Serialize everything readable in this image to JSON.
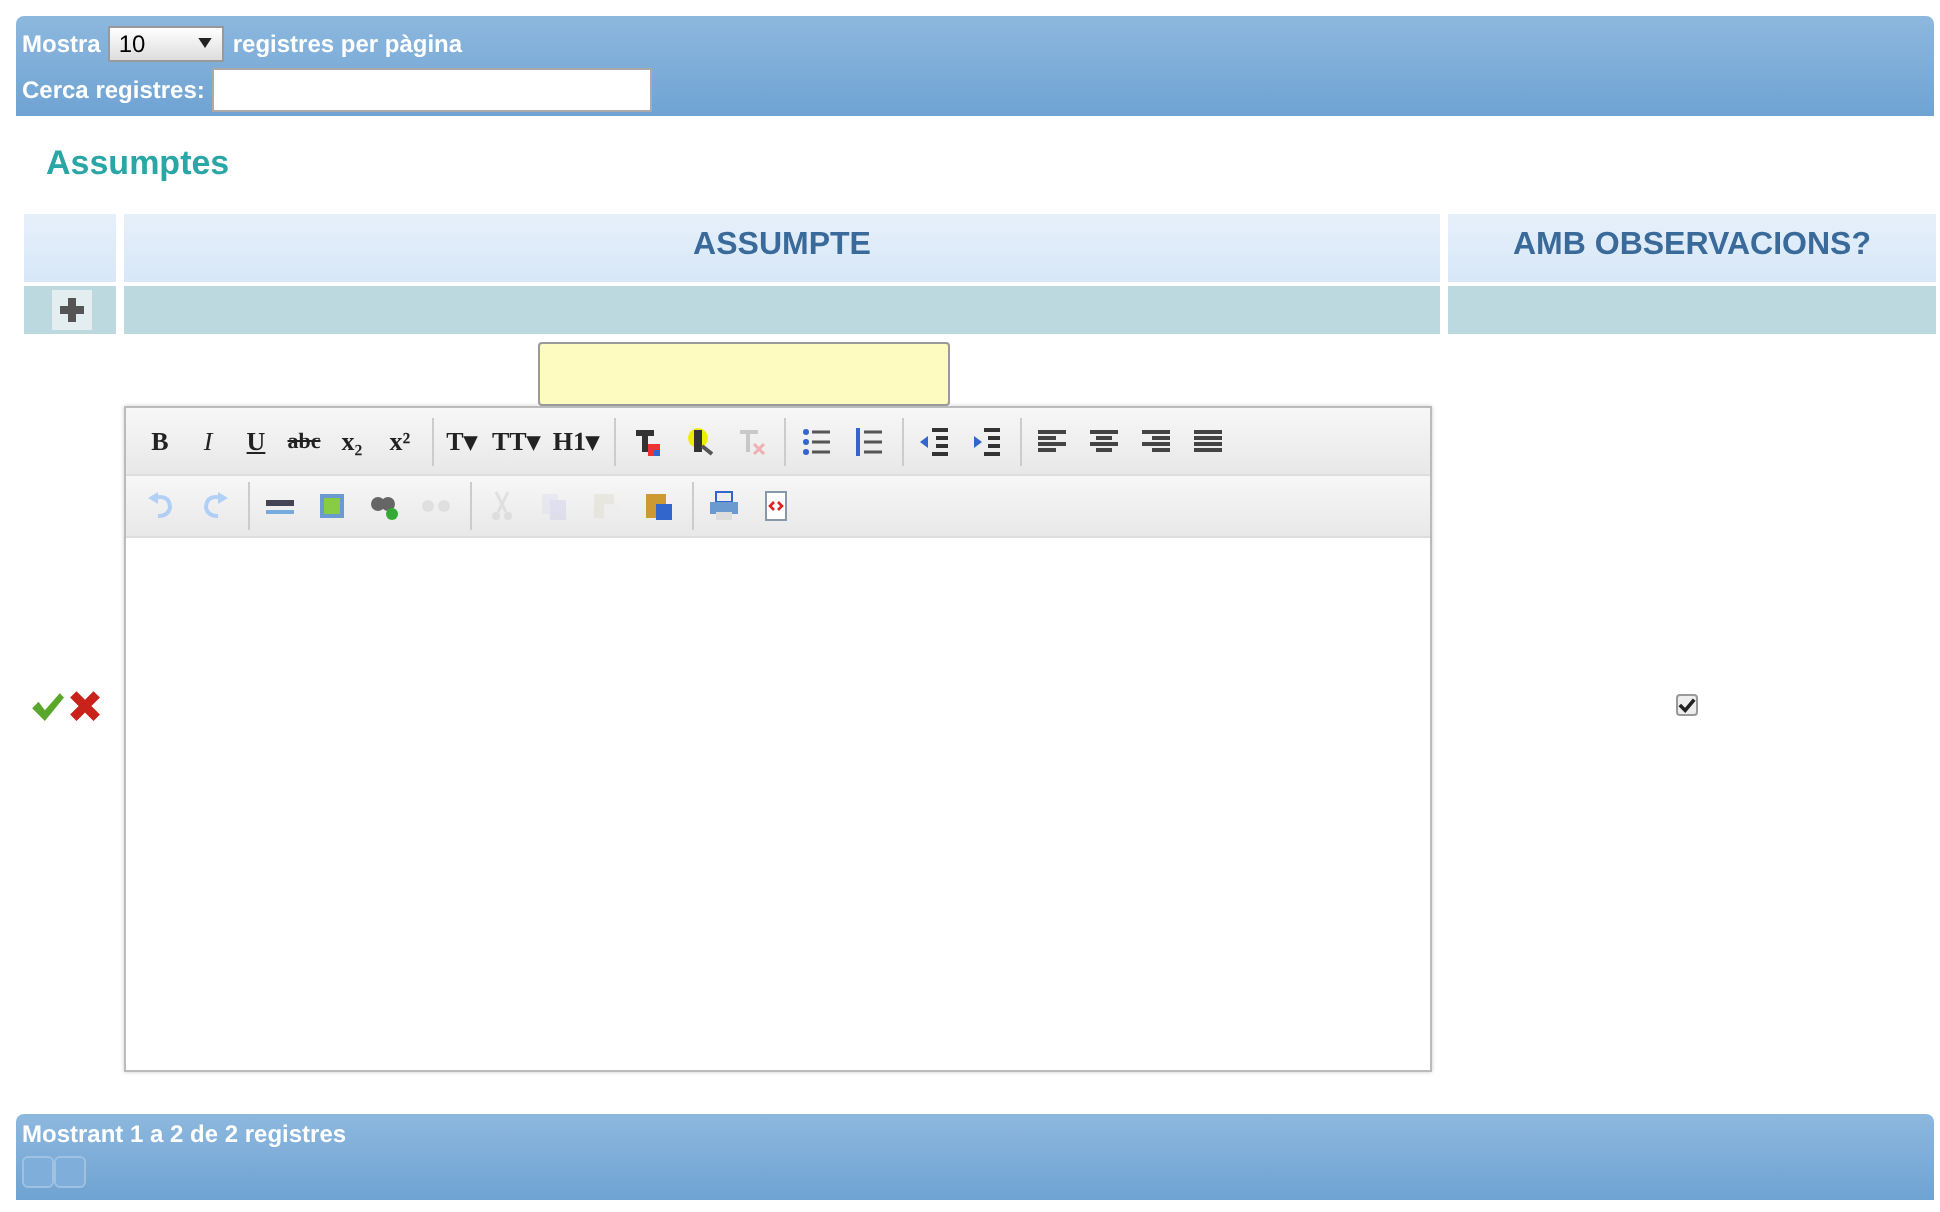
{
  "top_bar": {
    "show_label": "Mostra",
    "page_size": "10",
    "per_page_label": "registres per pàgina",
    "search_label": "Cerca registres:"
  },
  "title": "Assumptes",
  "table": {
    "columns": [
      "",
      "ASSUMPTE",
      "AMB OBSERVACIONS?"
    ],
    "edit_row": {
      "has_observations": true,
      "toolbar": [
        [
          {
            "kind": "bold",
            "text": "B",
            "disabled": false
          },
          {
            "kind": "italic",
            "text": "I",
            "disabled": false
          },
          {
            "kind": "underline",
            "text": "U",
            "disabled": false
          },
          {
            "kind": "strike",
            "text": "abc",
            "disabled": false
          },
          {
            "kind": "subscript",
            "text": "x₂",
            "disabled": false
          },
          {
            "kind": "superscript",
            "text": "x²",
            "disabled": false
          },
          {
            "kind": "sep"
          },
          {
            "kind": "font",
            "text": "T▾",
            "disabled": false
          },
          {
            "kind": "size",
            "text": "TT▾",
            "disabled": false
          },
          {
            "kind": "heading",
            "text": "H1▾",
            "disabled": false
          },
          {
            "kind": "sep"
          },
          {
            "kind": "textcolor",
            "disabled": false
          },
          {
            "kind": "bgcolor",
            "disabled": false
          },
          {
            "kind": "clearformat",
            "disabled": true
          },
          {
            "kind": "sep"
          },
          {
            "kind": "bullets",
            "disabled": false
          },
          {
            "kind": "numbers",
            "disabled": false
          },
          {
            "kind": "sep"
          },
          {
            "kind": "outdent",
            "disabled": false
          },
          {
            "kind": "indent",
            "disabled": false
          },
          {
            "kind": "sep"
          },
          {
            "kind": "alignleft",
            "disabled": false
          },
          {
            "kind": "aligncenter",
            "disabled": false
          },
          {
            "kind": "alignright",
            "disabled": false
          },
          {
            "kind": "justify",
            "disabled": false
          }
        ],
        [
          {
            "kind": "undo",
            "disabled": true
          },
          {
            "kind": "redo",
            "disabled": true
          },
          {
            "kind": "sep"
          },
          {
            "kind": "rule",
            "disabled": false
          },
          {
            "kind": "image",
            "disabled": false
          },
          {
            "kind": "link",
            "disabled": false
          },
          {
            "kind": "unlink",
            "disabled": true
          },
          {
            "kind": "sep"
          },
          {
            "kind": "cut",
            "disabled": true
          },
          {
            "kind": "copy",
            "disabled": true
          },
          {
            "kind": "paste",
            "disabled": true
          },
          {
            "kind": "pasteword",
            "disabled": false
          },
          {
            "kind": "sep"
          },
          {
            "kind": "print",
            "disabled": false
          },
          {
            "kind": "source",
            "disabled": false
          }
        ]
      ]
    }
  },
  "footer": {
    "info": "Mostrant 1 a 2 de 2 registres"
  }
}
